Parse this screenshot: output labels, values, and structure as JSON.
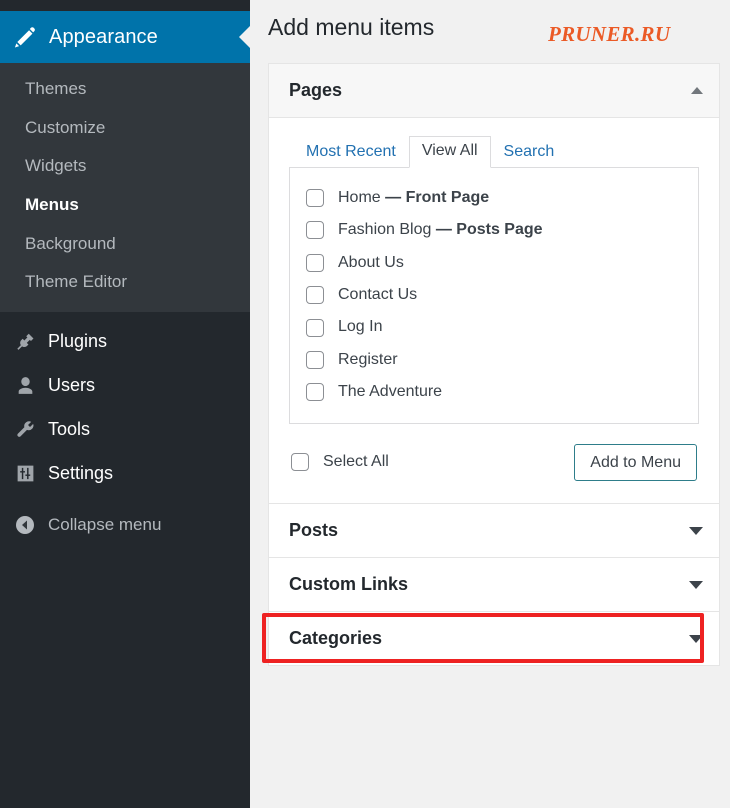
{
  "sidebar": {
    "active_menu": {
      "label": "Appearance",
      "icon": "paintbrush-icon",
      "bg_color": "#0073aa"
    },
    "submenu": [
      {
        "label": "Themes",
        "current": false
      },
      {
        "label": "Customize",
        "current": false
      },
      {
        "label": "Widgets",
        "current": false
      },
      {
        "label": "Menus",
        "current": true
      },
      {
        "label": "Background",
        "current": false
      },
      {
        "label": "Theme Editor",
        "current": false
      }
    ],
    "main_items": [
      {
        "label": "Plugins",
        "icon": "plug-icon"
      },
      {
        "label": "Users",
        "icon": "user-icon"
      },
      {
        "label": "Tools",
        "icon": "wrench-icon"
      },
      {
        "label": "Settings",
        "icon": "sliders-icon"
      }
    ],
    "collapse": {
      "label": "Collapse menu",
      "icon": "arrow-left-circle-icon"
    }
  },
  "main": {
    "page_title": "Add menu items",
    "watermark": "PRUNER.RU",
    "panels": [
      {
        "title": "Pages",
        "state": "open",
        "toggle_icon": "chevron-up-icon",
        "highlighted": false
      },
      {
        "title": "Posts",
        "state": "closed",
        "toggle_icon": "chevron-down-icon",
        "highlighted": true
      },
      {
        "title": "Custom Links",
        "state": "closed",
        "toggle_icon": "chevron-down-icon",
        "highlighted": false
      },
      {
        "title": "Categories",
        "state": "closed",
        "toggle_icon": "chevron-down-icon",
        "highlighted": false
      }
    ],
    "pages_panel": {
      "tabs": [
        {
          "label": "Most Recent",
          "active": false
        },
        {
          "label": "View All",
          "active": true
        },
        {
          "label": "Search",
          "active": false
        }
      ],
      "items": [
        {
          "name": "Home",
          "suffix": "— Front Page",
          "checked": false
        },
        {
          "name": "Fashion Blog",
          "suffix": "— Posts Page",
          "checked": false
        },
        {
          "name": "About Us",
          "suffix": "",
          "checked": false
        },
        {
          "name": "Contact Us",
          "suffix": "",
          "checked": false
        },
        {
          "name": "Log In",
          "suffix": "",
          "checked": false
        },
        {
          "name": "Register",
          "suffix": "",
          "checked": false
        },
        {
          "name": "The Adventure",
          "suffix": "",
          "checked": false
        }
      ],
      "select_all_label": "Select All",
      "add_to_menu_label": "Add to Menu"
    }
  },
  "colors": {
    "sidebar_bg": "#23282d",
    "submenu_bg": "#32373c",
    "accent_blue": "#0073aa",
    "link_blue": "#2271b1",
    "watermark_orange": "#eb5a26",
    "highlight_red": "#ee2222",
    "button_border_teal": "#2e7d8a"
  }
}
